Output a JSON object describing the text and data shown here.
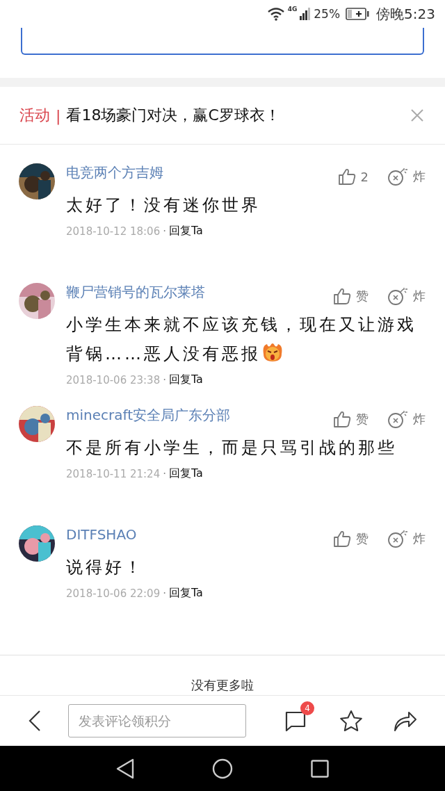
{
  "status_bar": {
    "network": "4G",
    "battery": "25%",
    "time": "傍晚5:23"
  },
  "more_button": {
    "kind": "outline"
  },
  "activity": {
    "tag": "活动",
    "separator": "|",
    "text": "看18场豪门对决，赢C罗球衣！"
  },
  "comments": [
    {
      "user": "电竞两个方吉姆",
      "likes": "2",
      "bomb": "炸",
      "content": "太好了！没有迷你世界",
      "emoji": false,
      "date": "2018-10-12 18:06",
      "dot": "·",
      "reply": "回复Ta"
    },
    {
      "user": "鞭尸营销号的瓦尔莱塔",
      "likes": "赞",
      "bomb": "炸",
      "content": "小学生本来就不应该充钱，现在又让游戏背锅……恶人没有恶报",
      "emoji": true,
      "date": "2018-10-06 23:38",
      "dot": "·",
      "reply": "回复Ta"
    },
    {
      "user": "minecraft安全局广东分部",
      "likes": "赞",
      "bomb": "炸",
      "content": "不是所有小学生，而是只骂引战的那些",
      "emoji": false,
      "date": "2018-10-11 21:24",
      "dot": "·",
      "reply": "回复Ta"
    },
    {
      "user": "DITFSHAO",
      "likes": "赞",
      "bomb": "炸",
      "content": "说得好！",
      "emoji": false,
      "date": "2018-10-06 22:09",
      "dot": "·",
      "reply": "回复Ta"
    }
  ],
  "end_text": "没有更多啦",
  "bottom_bar": {
    "placeholder": "发表评论领积分",
    "comment_badge": "4"
  }
}
